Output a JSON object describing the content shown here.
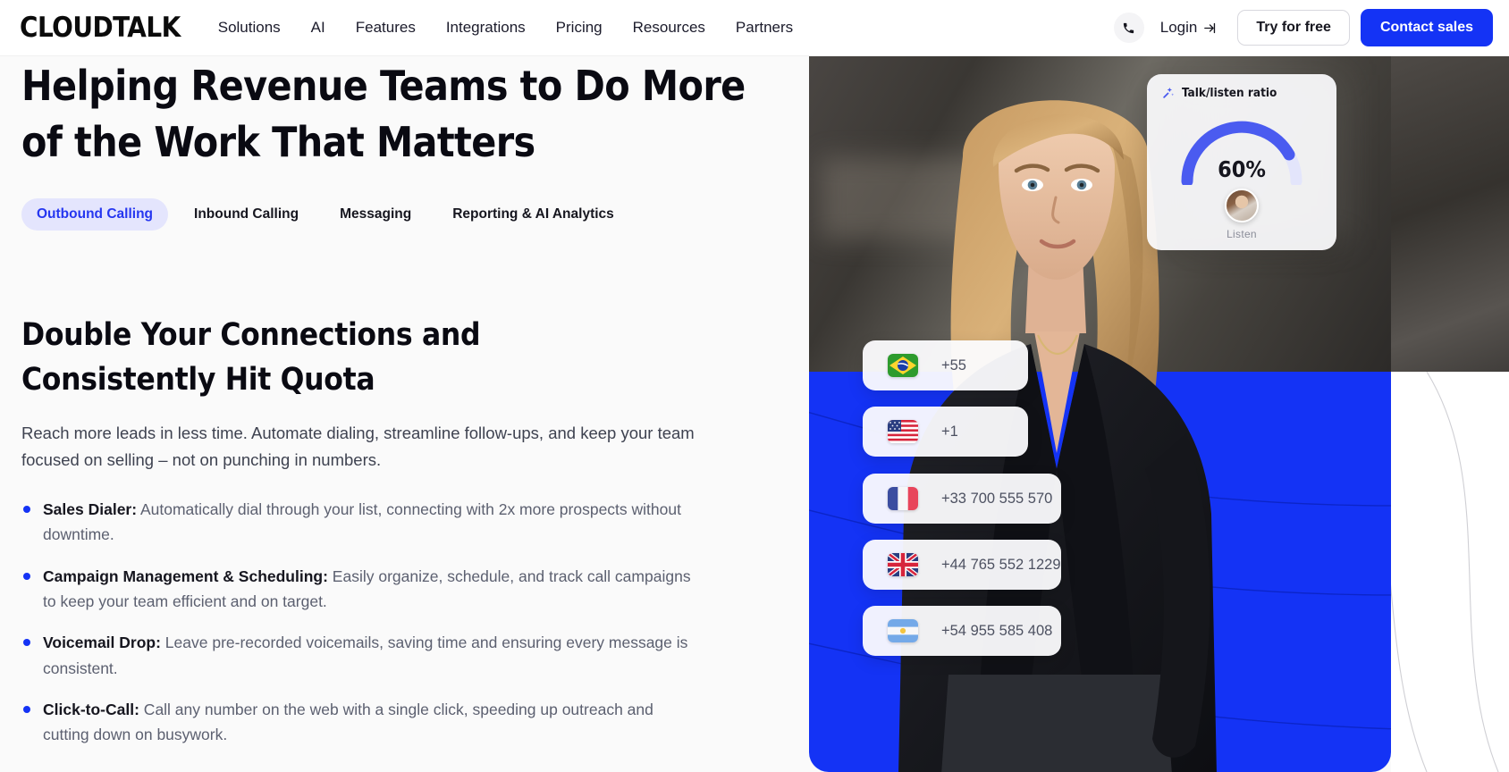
{
  "nav": {
    "logo": "CLOUDTALK",
    "links": [
      {
        "label": "Solutions"
      },
      {
        "label": "AI"
      },
      {
        "label": "Features"
      },
      {
        "label": "Integrations"
      },
      {
        "label": "Pricing"
      },
      {
        "label": "Resources"
      },
      {
        "label": "Partners"
      }
    ],
    "phone_icon": "phone-icon",
    "login_label": "Login",
    "login_icon": "login-arrow-icon",
    "try_free_label": "Try for free",
    "contact_sales_label": "Contact sales"
  },
  "hero": {
    "title": "Helping Revenue Teams to Do More of the Work That Matters",
    "tabs": [
      {
        "label": "Outbound Calling",
        "active": true
      },
      {
        "label": "Inbound Calling",
        "active": false
      },
      {
        "label": "Messaging",
        "active": false
      },
      {
        "label": "Reporting & AI Analytics",
        "active": false
      }
    ]
  },
  "section": {
    "heading": "Double Your Connections and Consistently Hit Quota",
    "lede": "Reach more leads in less time. Automate dialing, streamline follow-ups, and keep your team focused on selling – not on punching in numbers.",
    "bullets": [
      {
        "label": "Sales Dialer:",
        "text": " Automatically dial through your list, connecting with 2x more prospects without downtime."
      },
      {
        "label": "Campaign Management & Scheduling:",
        "text": " Easily organize, schedule, and track call campaigns to keep your team efficient and on target."
      },
      {
        "label": "Voicemail Drop:",
        "text": " Leave pre-recorded voicemails, saving time and ensuring every message is consistent."
      },
      {
        "label": "Click-to-Call:",
        "text": " Call any number on the web with a single click, speeding up outreach and cutting down on busywork."
      }
    ]
  },
  "visual": {
    "ratio_card": {
      "icon": "sparkle-wand-icon",
      "title": "Talk/listen ratio",
      "percent": "60%",
      "listen_label": "Listen",
      "gauge_value": 60,
      "avatar": "agent-avatar"
    },
    "phone_cards": [
      {
        "country": "Brazil",
        "flag": "flag-br",
        "number": "+55"
      },
      {
        "country": "United States",
        "flag": "flag-us",
        "number": "+1"
      },
      {
        "country": "France",
        "flag": "flag-fr",
        "number": "+33 700 555 570"
      },
      {
        "country": "United Kingdom",
        "flag": "flag-gb",
        "number": "+44 765 552 1229"
      },
      {
        "country": "Argentina",
        "flag": "flag-ar",
        "number": "+54 955 585 408"
      }
    ]
  },
  "colors": {
    "brand_blue": "#1433f5",
    "pill_bg": "#e4e5fd",
    "pill_text": "#2536f0",
    "page_bg": "#fafafa",
    "text_dark": "#16161f",
    "text_muted": "#5c6070"
  }
}
